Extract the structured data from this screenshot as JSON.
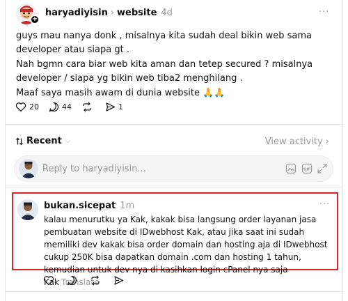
{
  "post": {
    "username": "haryadiyisin",
    "topic": "website",
    "time": "4d",
    "more_label": "···",
    "paragraphs": [
      "guys mau nanya donk , misalnya kita sudah deal bikin web sama developer atau siapa gt .",
      "Nah bgmn cara biar web kita aman dan tetep secured ? misalnya developer / siapa yg bikin web tiba2 menghilang .",
      "Maaf saya masih awam di dunia website 🙏🙏"
    ],
    "likes": "20",
    "replies": "44",
    "shares": "1"
  },
  "sort": {
    "label": "Recent",
    "icon": "sort-arrows-icon"
  },
  "view_activity": "View activity",
  "reply_box": {
    "placeholder": "Reply to haryadiyisin..."
  },
  "reply": {
    "username": "bukan.sicepat",
    "time": "1m",
    "more_label": "···",
    "text": "kalau menurutku ya Kak, kakak bisa langsung order layanan jasa pembuatan website di IDwebhost Kak, atau jika saat ini sudah memiliki dev kakak bisa order domain dan hosting aja di IDwebhost cukup 250K bisa dapatkan domain .com dan hosting 1 tahun, kemudian untuk dev nya di kasihkan login cPanel nya saja Kak",
    "translate": "Translate"
  },
  "colors": {
    "highlight_border": "#d62727",
    "muted": "#999999"
  }
}
